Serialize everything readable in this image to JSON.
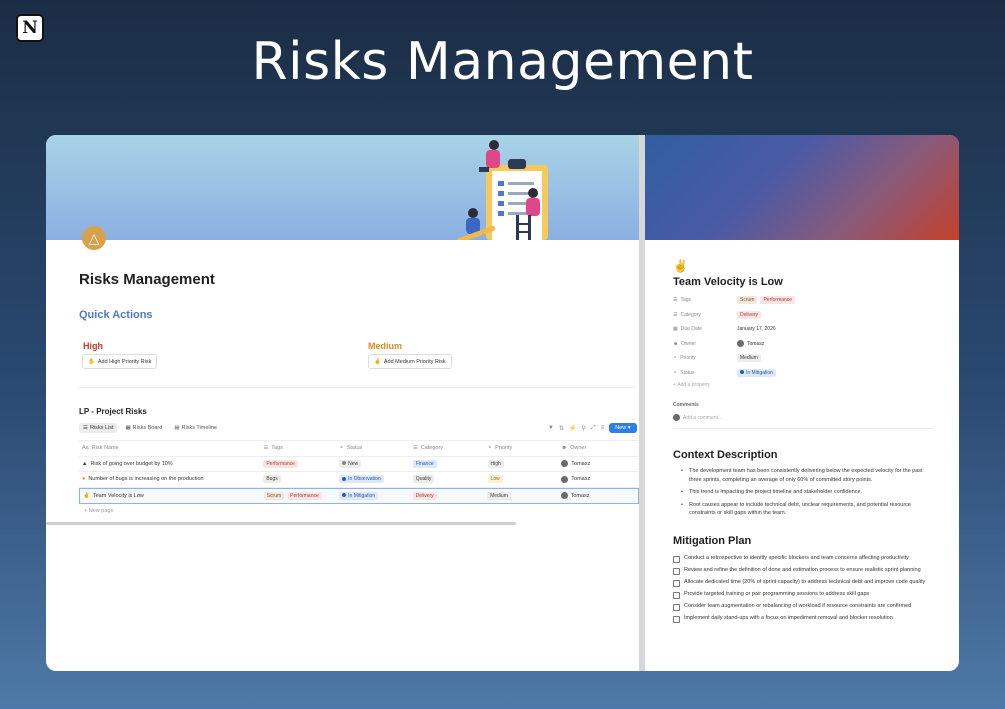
{
  "brand": {
    "logo_letter": "N"
  },
  "hero_title": "Risks Management",
  "left": {
    "page_title": "Risks Management",
    "quick_actions": "Quick Actions",
    "high_label": "High",
    "high_button": "Add High Priority Risk",
    "medium_label": "Medium",
    "medium_button": "Add Medium Priority Risk",
    "db_title": "LP - Project Risks",
    "tabs": [
      "Risks List",
      "Risks Board",
      "Risks Timeline"
    ],
    "new_button": "New",
    "columns": [
      "Risk Name",
      "Tags",
      "Status",
      "Category",
      "Priority",
      "Owner"
    ],
    "rows": [
      {
        "name": "Risk of going over budget by 10%",
        "tags": [
          "Performance"
        ],
        "status": "New",
        "category": "Finance",
        "priority": "High",
        "owner": "Tomasz"
      },
      {
        "name": "Number of bugs is increasing on the production",
        "tags": [
          "Bugs"
        ],
        "status": "In Observation",
        "category": "Quality",
        "priority": "Low",
        "owner": "Tomasz"
      },
      {
        "name": "Team Velocity is Low",
        "tags": [
          "Scrum",
          "Performance"
        ],
        "status": "In Mitigation",
        "category": "Delivery",
        "priority": "Medium",
        "owner": "Tomasz"
      }
    ],
    "new_page": "New page"
  },
  "right": {
    "title": "Team Velocity is Low",
    "props": [
      {
        "key": "Tags",
        "values": [
          "Scrum",
          "Performance"
        ]
      },
      {
        "key": "Category",
        "values": [
          "Delivery"
        ]
      },
      {
        "key": "Due Date",
        "values": [
          "January 17, 2026"
        ]
      },
      {
        "key": "Owner",
        "values": [
          "Tomasz"
        ]
      },
      {
        "key": "Priority",
        "values": [
          "Medium"
        ]
      },
      {
        "key": "Status",
        "values": [
          "In Mitigation"
        ]
      }
    ],
    "add_property": "Add a property",
    "comments_label": "Comments",
    "add_comment": "Add a comment...",
    "context_heading": "Context Description",
    "context_bullets": [
      "The development team has been consistently delivering below the expected velocity for the past three sprints, completing an average of only 60% of committed story points.",
      "This trend is impacting the project timeline and stakeholder confidence.",
      "Root causes appear to include technical debt, unclear requirements, and potential resource constraints or skill gaps within the team."
    ],
    "mitigation_heading": "Mitigation Plan",
    "mitigation_items": [
      "Conduct a retrospective to identify specific blockers and team concerns affecting productivity",
      "Review and refine the definition of done and estimation process to ensure realistic sprint planning",
      "Allocate dedicated time (20% of sprint capacity) to address technical debt and improve code quality",
      "Provide targeted training or pair programming sessions to address skill gaps",
      "Consider team augmentation or rebalancing of workload if resource constraints are confirmed",
      "Implement daily stand-ups with a focus on impediment removal and blocker resolution"
    ]
  }
}
